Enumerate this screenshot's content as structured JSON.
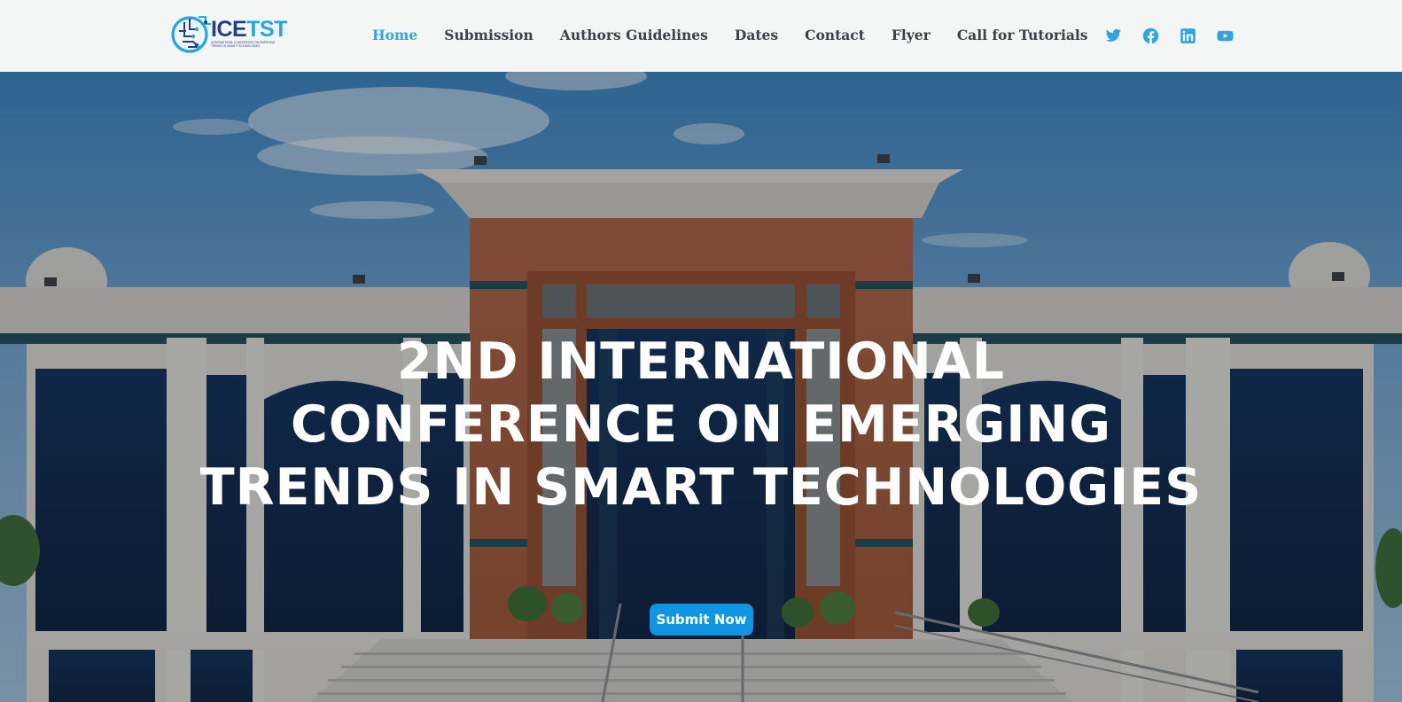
{
  "logo": {
    "word_main": "ICE",
    "word_accent": "TST",
    "tagline": "INTERNATIONAL CONFERENCE ON EMERGING TRENDS IN SMART TECHNOLOGIES"
  },
  "nav": {
    "items": [
      {
        "label": "Home",
        "active": true
      },
      {
        "label": "Submission"
      },
      {
        "label": "Authors Guidelines"
      },
      {
        "label": "Dates"
      },
      {
        "label": "Contact"
      },
      {
        "label": "Flyer"
      },
      {
        "label": "Call for Tutorials"
      }
    ]
  },
  "social": {
    "icons": [
      "twitter-icon",
      "facebook-icon",
      "linkedin-icon",
      "youtube-icon"
    ]
  },
  "hero": {
    "title_lines": [
      "2ND INTERNATIONAL",
      "CONFERENCE ON EMERGING",
      "TRENDS IN SMART TECHNOLOGIES"
    ],
    "cta_label": "Submit Now"
  },
  "colors": {
    "accent": "#2fa5e0",
    "button": "#1195e0",
    "nav_text": "#3b4146",
    "logo_dark": "#1f3f8f"
  }
}
